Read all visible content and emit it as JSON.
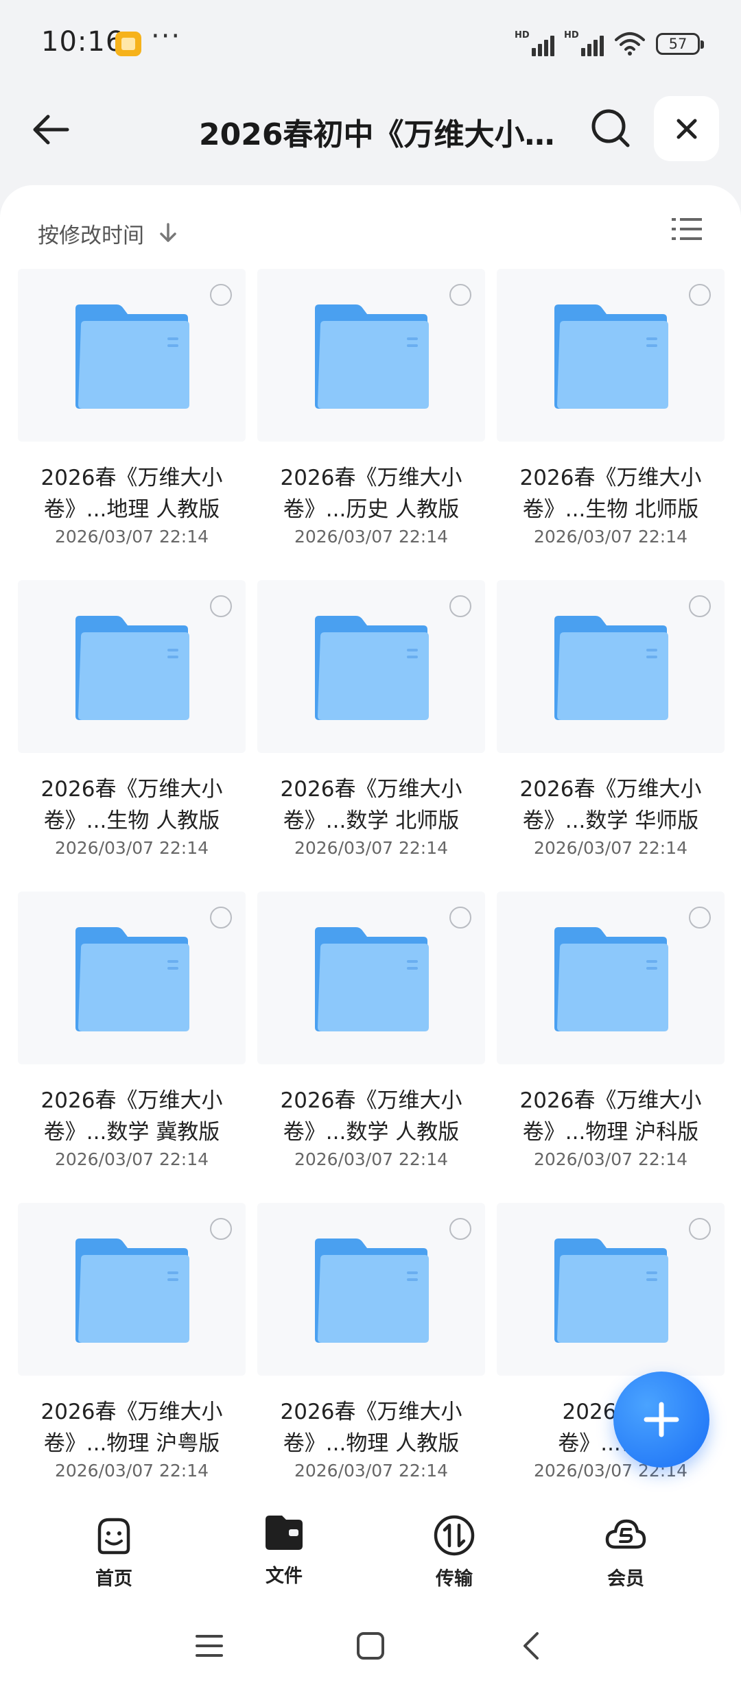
{
  "status_bar": {
    "time": "10:16",
    "dots": "···",
    "signal_1": "HD",
    "signal_2": "HD",
    "battery": "57"
  },
  "header": {
    "title": "2026春初中《万维大小…",
    "back_icon": "arrow-left-icon",
    "search_icon": "search-icon",
    "close_icon": "close-icon"
  },
  "toolbar": {
    "sort_label": "按修改时间",
    "sort_icon": "arrow-down-icon",
    "view_icon": "list-view-icon"
  },
  "files": [
    {
      "name_line1": "2026春《万维大小",
      "name_line2": "卷》...地理 人教版",
      "date": "2026/03/07 22:14"
    },
    {
      "name_line1": "2026春《万维大小",
      "name_line2": "卷》...历史 人教版",
      "date": "2026/03/07 22:14"
    },
    {
      "name_line1": "2026春《万维大小",
      "name_line2": "卷》...生物 北师版",
      "date": "2026/03/07 22:14"
    },
    {
      "name_line1": "2026春《万维大小",
      "name_line2": "卷》...生物 人教版",
      "date": "2026/03/07 22:14"
    },
    {
      "name_line1": "2026春《万维大小",
      "name_line2": "卷》...数学 北师版",
      "date": "2026/03/07 22:14"
    },
    {
      "name_line1": "2026春《万维大小",
      "name_line2": "卷》...数学 华师版",
      "date": "2026/03/07 22:14"
    },
    {
      "name_line1": "2026春《万维大小",
      "name_line2": "卷》...数学 冀教版",
      "date": "2026/03/07 22:14"
    },
    {
      "name_line1": "2026春《万维大小",
      "name_line2": "卷》...数学 人教版",
      "date": "2026/03/07 22:14"
    },
    {
      "name_line1": "2026春《万维大小",
      "name_line2": "卷》...物理 沪科版",
      "date": "2026/03/07 22:14"
    },
    {
      "name_line1": "2026春《万维大小",
      "name_line2": "卷》...物理 沪粤版",
      "date": "2026/03/07 22:14"
    },
    {
      "name_line1": "2026春《万维大小",
      "name_line2": "卷》...物理 人教版",
      "date": "2026/03/07 22:14"
    },
    {
      "name_line1": "2026春《",
      "name_line2": "卷》...语文",
      "date": "2026/03/07 22:14"
    }
  ],
  "fab": {
    "icon": "plus-icon"
  },
  "bottom_nav": [
    {
      "label": "首页",
      "icon": "home-smile-icon"
    },
    {
      "label": "文件",
      "icon": "folder-icon"
    },
    {
      "label": "传输",
      "icon": "transfer-icon"
    },
    {
      "label": "会员",
      "icon": "vip-cloud-icon"
    }
  ],
  "colors": {
    "folder_front": "#8cc8fb",
    "folder_back": "#4aa0f0",
    "accent": "#1a6ff5"
  }
}
